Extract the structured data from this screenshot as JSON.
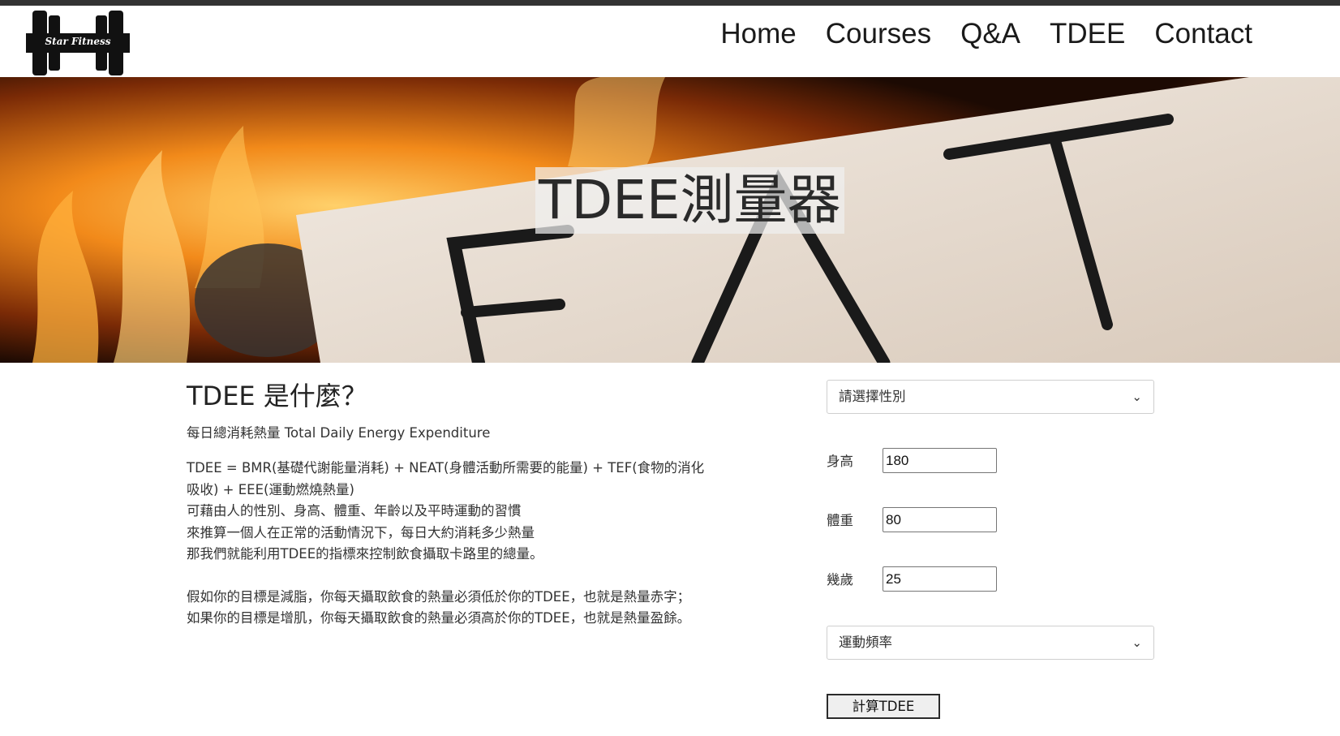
{
  "header": {
    "logo_text": "Star Fitness",
    "nav": [
      "Home",
      "Courses",
      "Q&A",
      "TDEE",
      "Contact"
    ]
  },
  "hero": {
    "title": "TDEE測量器",
    "image_text": "FAT"
  },
  "intro": {
    "heading": "TDEE 是什麼？",
    "subtitle": "每日總消耗熱量 Total Daily Energy Expenditure",
    "lines": [
      "TDEE = BMR(基礎代謝能量消耗) + NEAT(身體活動所需要的能量) + TEF(食物的消化",
      "吸收) + EEE(運動燃燒熱量)",
      "可藉由人的性別、身高、體重、年齡以及平時運動的習慣",
      "來推算一個人在正常的活動情況下，每日大約消耗多少熱量",
      "那我們就能利用TDEE的指標來控制飲食攝取卡路里的總量。"
    ],
    "goal_lines": [
      "假如你的目標是減脂，你每天攝取飲食的熱量必須低於你的TDEE，也就是熱量赤字；",
      "如果你的目標是增肌，你每天攝取飲食的熱量必須高於你的TDEE，也就是熱量盈餘。"
    ]
  },
  "form": {
    "gender_select": "請選擇性別",
    "height_label": "身高",
    "height_value": "180",
    "weight_label": "體重",
    "weight_value": "80",
    "age_label": "幾歲",
    "age_value": "25",
    "activity_select": "運動頻率",
    "submit_label": "計算TDEE"
  },
  "colors": {
    "topbar": "#333333",
    "flame_orange": "#f28a1a",
    "paper": "#e8ddd2"
  }
}
